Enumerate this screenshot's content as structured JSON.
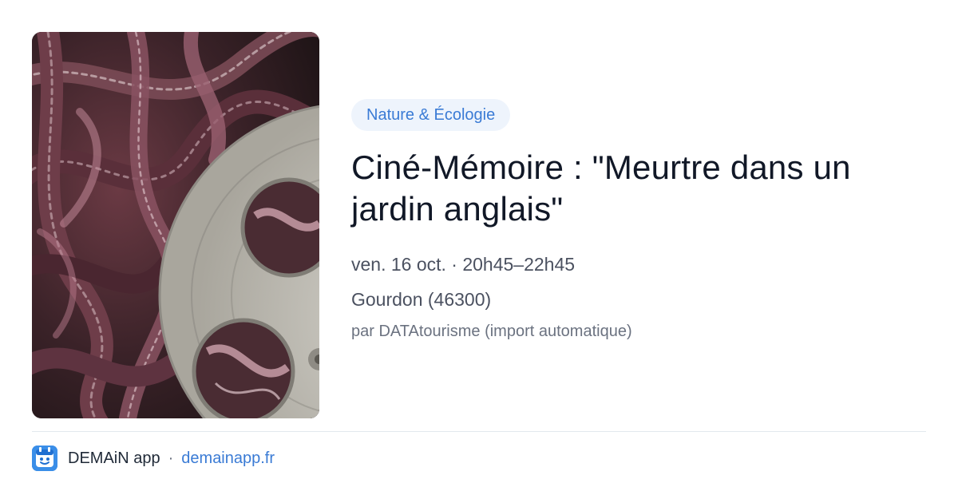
{
  "event": {
    "image_alt": "Bobine de film et pellicule",
    "category": "Nature & Écologie",
    "title": "Ciné-Mémoire : \"Meurtre dans un jardin anglais\"",
    "date": "ven. 16 oct. · 20h45–22h45",
    "location": "Gourdon (46300)",
    "source": "par DATAtourisme (import automatique)"
  },
  "footer": {
    "app_icon": "demain-app-logo-icon",
    "app_name": "DEMAiN app",
    "separator": "·",
    "app_url": "demainapp.fr"
  },
  "colors": {
    "accent": "#3a7bd5",
    "tag_background": "#eef4fc",
    "title": "#111827",
    "meta": "#4b5160",
    "divider": "#e2e8ee",
    "app_icon": "#3a8ee8"
  }
}
